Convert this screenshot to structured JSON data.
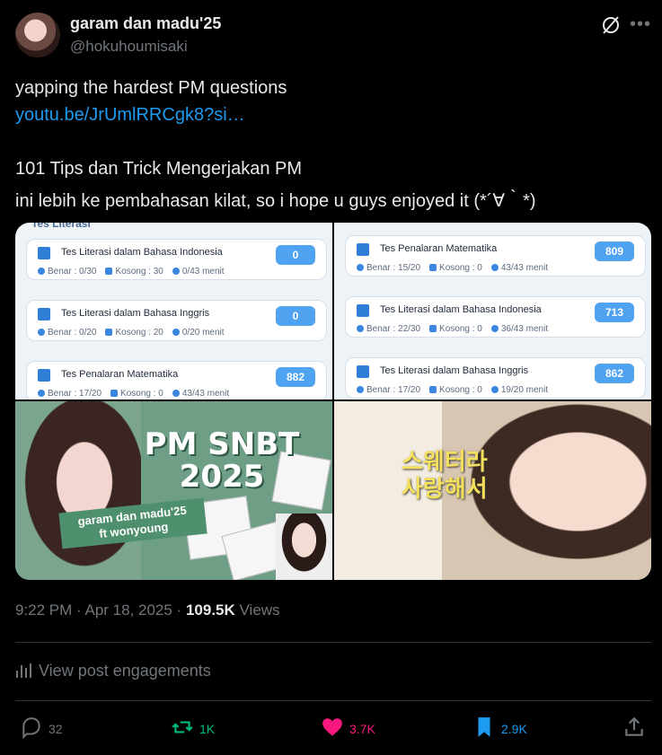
{
  "author": {
    "display_name": "garam dan madu'25",
    "handle": "@hokuhoumisaki"
  },
  "post": {
    "line1": "yapping the hardest PM questions",
    "link": "youtu.be/JrUmlRRCgk8?si…",
    "line3": "101 Tips dan Trick Mengerjakan PM",
    "line4": "ini lebih ke pembahasan kilat, so i hope u guys enjoyed it (*´∀｀*)"
  },
  "media": {
    "left_cut_title": "Tes Literasi",
    "left_cards": [
      {
        "title": "Tes Literasi dalam Bahasa Indonesia",
        "score": "0",
        "benar": "Benar : 0/30",
        "kosong": "Kosong : 30",
        "time": "0/43 menit"
      },
      {
        "title": "Tes Literasi dalam Bahasa Inggris",
        "score": "0",
        "benar": "Benar : 0/20",
        "kosong": "Kosong : 20",
        "time": "0/20 menit"
      },
      {
        "title": "Tes Penalaran Matematika",
        "score": "882",
        "benar": "Benar : 17/20",
        "kosong": "Kosong : 0",
        "time": "43/43 menit"
      }
    ],
    "right_cards": [
      {
        "title": "Tes Penalaran Matematika",
        "score": "809",
        "benar": "Benar : 15/20",
        "kosong": "Kosong : 0",
        "time": "43/43 menit"
      },
      {
        "title": "Tes Literasi dalam Bahasa Indonesia",
        "score": "713",
        "benar": "Benar : 22/30",
        "kosong": "Kosong : 0",
        "time": "36/43 menit"
      },
      {
        "title": "Tes Literasi dalam Bahasa Inggris",
        "score": "862",
        "benar": "Benar : 17/20",
        "kosong": "Kosong : 0",
        "time": "19/20 menit"
      }
    ],
    "poster_title": "PM SNBT 2025",
    "poster_sub_1": "garam dan madu'25",
    "poster_sub_2": "ft wonyoung",
    "korean_1": "스웨터라",
    "korean_2": "사랑해서"
  },
  "meta": {
    "time": "9:22 PM · Apr 18, 2025 · ",
    "views_count": "109.5K",
    "views_label": " Views"
  },
  "engagements_label": "View post engagements",
  "actions": {
    "replies": "32",
    "reposts": "1K",
    "likes": "3.7K",
    "bookmarks": "2.9K"
  },
  "colors": {
    "accent": "#1d9bf0",
    "repost": "#00ba7c",
    "like": "#f91880",
    "muted": "#71767b"
  }
}
